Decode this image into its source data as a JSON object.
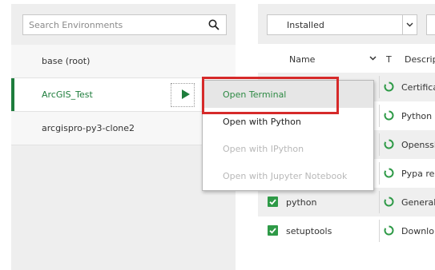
{
  "search": {
    "placeholder": "Search Environments",
    "icon": "search-icon"
  },
  "environments": [
    {
      "label": "base (root)",
      "selected": false
    },
    {
      "label": "ArcGIS_Test",
      "selected": true
    },
    {
      "label": "arcgispro-py3-clone2",
      "selected": false
    }
  ],
  "filter": {
    "value": "Installed"
  },
  "columns": {
    "name": "Name",
    "type": "T",
    "description": "Descrip"
  },
  "packages": [
    {
      "name": "",
      "checked": false,
      "description": "Certifica"
    },
    {
      "name": "",
      "checked": false,
      "description": "Python"
    },
    {
      "name": "",
      "checked": false,
      "description": "Openssl"
    },
    {
      "name": "",
      "checked": false,
      "description": "Pypa re"
    },
    {
      "name": "python",
      "checked": true,
      "description": "General"
    },
    {
      "name": "setuptools",
      "checked": true,
      "description": "Downlo"
    }
  ],
  "context_menu": {
    "items": [
      {
        "label": "Open Terminal",
        "state": "active"
      },
      {
        "label": "Open with Python",
        "state": "enabled"
      },
      {
        "label": "Open with IPython",
        "state": "disabled"
      },
      {
        "label": "Open with Jupyter Notebook",
        "state": "disabled"
      }
    ]
  },
  "colors": {
    "accent": "#1e7d3c",
    "highlight": "#d62a2a",
    "check": "#2e9a47"
  }
}
